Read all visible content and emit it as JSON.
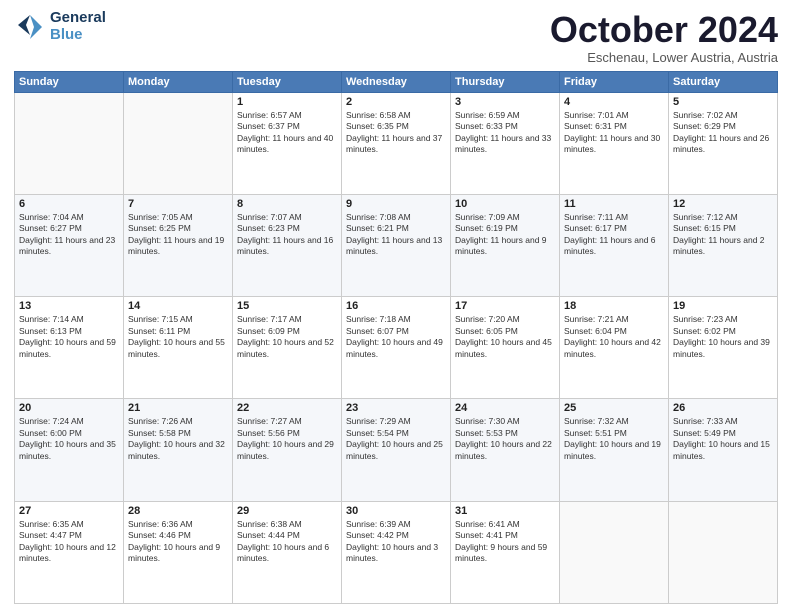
{
  "header": {
    "logo_line1": "General",
    "logo_line2": "Blue",
    "month": "October 2024",
    "location": "Eschenau, Lower Austria, Austria"
  },
  "weekdays": [
    "Sunday",
    "Monday",
    "Tuesday",
    "Wednesday",
    "Thursday",
    "Friday",
    "Saturday"
  ],
  "rows": [
    [
      {
        "day": "",
        "info": ""
      },
      {
        "day": "",
        "info": ""
      },
      {
        "day": "1",
        "info": "Sunrise: 6:57 AM\nSunset: 6:37 PM\nDaylight: 11 hours and 40 minutes."
      },
      {
        "day": "2",
        "info": "Sunrise: 6:58 AM\nSunset: 6:35 PM\nDaylight: 11 hours and 37 minutes."
      },
      {
        "day": "3",
        "info": "Sunrise: 6:59 AM\nSunset: 6:33 PM\nDaylight: 11 hours and 33 minutes."
      },
      {
        "day": "4",
        "info": "Sunrise: 7:01 AM\nSunset: 6:31 PM\nDaylight: 11 hours and 30 minutes."
      },
      {
        "day": "5",
        "info": "Sunrise: 7:02 AM\nSunset: 6:29 PM\nDaylight: 11 hours and 26 minutes."
      }
    ],
    [
      {
        "day": "6",
        "info": "Sunrise: 7:04 AM\nSunset: 6:27 PM\nDaylight: 11 hours and 23 minutes."
      },
      {
        "day": "7",
        "info": "Sunrise: 7:05 AM\nSunset: 6:25 PM\nDaylight: 11 hours and 19 minutes."
      },
      {
        "day": "8",
        "info": "Sunrise: 7:07 AM\nSunset: 6:23 PM\nDaylight: 11 hours and 16 minutes."
      },
      {
        "day": "9",
        "info": "Sunrise: 7:08 AM\nSunset: 6:21 PM\nDaylight: 11 hours and 13 minutes."
      },
      {
        "day": "10",
        "info": "Sunrise: 7:09 AM\nSunset: 6:19 PM\nDaylight: 11 hours and 9 minutes."
      },
      {
        "day": "11",
        "info": "Sunrise: 7:11 AM\nSunset: 6:17 PM\nDaylight: 11 hours and 6 minutes."
      },
      {
        "day": "12",
        "info": "Sunrise: 7:12 AM\nSunset: 6:15 PM\nDaylight: 11 hours and 2 minutes."
      }
    ],
    [
      {
        "day": "13",
        "info": "Sunrise: 7:14 AM\nSunset: 6:13 PM\nDaylight: 10 hours and 59 minutes."
      },
      {
        "day": "14",
        "info": "Sunrise: 7:15 AM\nSunset: 6:11 PM\nDaylight: 10 hours and 55 minutes."
      },
      {
        "day": "15",
        "info": "Sunrise: 7:17 AM\nSunset: 6:09 PM\nDaylight: 10 hours and 52 minutes."
      },
      {
        "day": "16",
        "info": "Sunrise: 7:18 AM\nSunset: 6:07 PM\nDaylight: 10 hours and 49 minutes."
      },
      {
        "day": "17",
        "info": "Sunrise: 7:20 AM\nSunset: 6:05 PM\nDaylight: 10 hours and 45 minutes."
      },
      {
        "day": "18",
        "info": "Sunrise: 7:21 AM\nSunset: 6:04 PM\nDaylight: 10 hours and 42 minutes."
      },
      {
        "day": "19",
        "info": "Sunrise: 7:23 AM\nSunset: 6:02 PM\nDaylight: 10 hours and 39 minutes."
      }
    ],
    [
      {
        "day": "20",
        "info": "Sunrise: 7:24 AM\nSunset: 6:00 PM\nDaylight: 10 hours and 35 minutes."
      },
      {
        "day": "21",
        "info": "Sunrise: 7:26 AM\nSunset: 5:58 PM\nDaylight: 10 hours and 32 minutes."
      },
      {
        "day": "22",
        "info": "Sunrise: 7:27 AM\nSunset: 5:56 PM\nDaylight: 10 hours and 29 minutes."
      },
      {
        "day": "23",
        "info": "Sunrise: 7:29 AM\nSunset: 5:54 PM\nDaylight: 10 hours and 25 minutes."
      },
      {
        "day": "24",
        "info": "Sunrise: 7:30 AM\nSunset: 5:53 PM\nDaylight: 10 hours and 22 minutes."
      },
      {
        "day": "25",
        "info": "Sunrise: 7:32 AM\nSunset: 5:51 PM\nDaylight: 10 hours and 19 minutes."
      },
      {
        "day": "26",
        "info": "Sunrise: 7:33 AM\nSunset: 5:49 PM\nDaylight: 10 hours and 15 minutes."
      }
    ],
    [
      {
        "day": "27",
        "info": "Sunrise: 6:35 AM\nSunset: 4:47 PM\nDaylight: 10 hours and 12 minutes."
      },
      {
        "day": "28",
        "info": "Sunrise: 6:36 AM\nSunset: 4:46 PM\nDaylight: 10 hours and 9 minutes."
      },
      {
        "day": "29",
        "info": "Sunrise: 6:38 AM\nSunset: 4:44 PM\nDaylight: 10 hours and 6 minutes."
      },
      {
        "day": "30",
        "info": "Sunrise: 6:39 AM\nSunset: 4:42 PM\nDaylight: 10 hours and 3 minutes."
      },
      {
        "day": "31",
        "info": "Sunrise: 6:41 AM\nSunset: 4:41 PM\nDaylight: 9 hours and 59 minutes."
      },
      {
        "day": "",
        "info": ""
      },
      {
        "day": "",
        "info": ""
      }
    ]
  ]
}
